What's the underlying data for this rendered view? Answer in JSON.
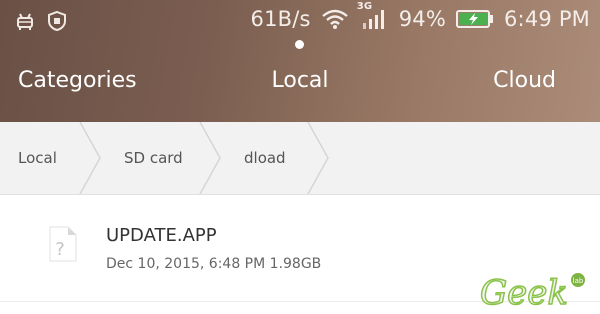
{
  "status_bar": {
    "speed": "61B/s",
    "network_type": "3G",
    "battery_percent": "94%",
    "time": "6:49 PM",
    "icons": [
      "android-debug-icon",
      "shield-icon",
      "wifi-icon",
      "cell-signal-icon",
      "battery-charging-icon"
    ]
  },
  "tabs": [
    {
      "label": "Categories"
    },
    {
      "label": "Local",
      "selected": true
    },
    {
      "label": "Cloud"
    }
  ],
  "breadcrumbs": [
    {
      "label": "Local"
    },
    {
      "label": "SD card"
    },
    {
      "label": "dload"
    }
  ],
  "files": [
    {
      "name": "UPDATE.APP",
      "date": "Dec 10, 2015, 6:48 PM",
      "size": "1.98GB",
      "icon": "unknown-file-icon"
    }
  ],
  "watermark": {
    "text": "Geek",
    "badge": "lab",
    "colors": {
      "fill": "#f3f3f3",
      "outline": "#8bc34a",
      "badge": "#7cb342"
    }
  }
}
